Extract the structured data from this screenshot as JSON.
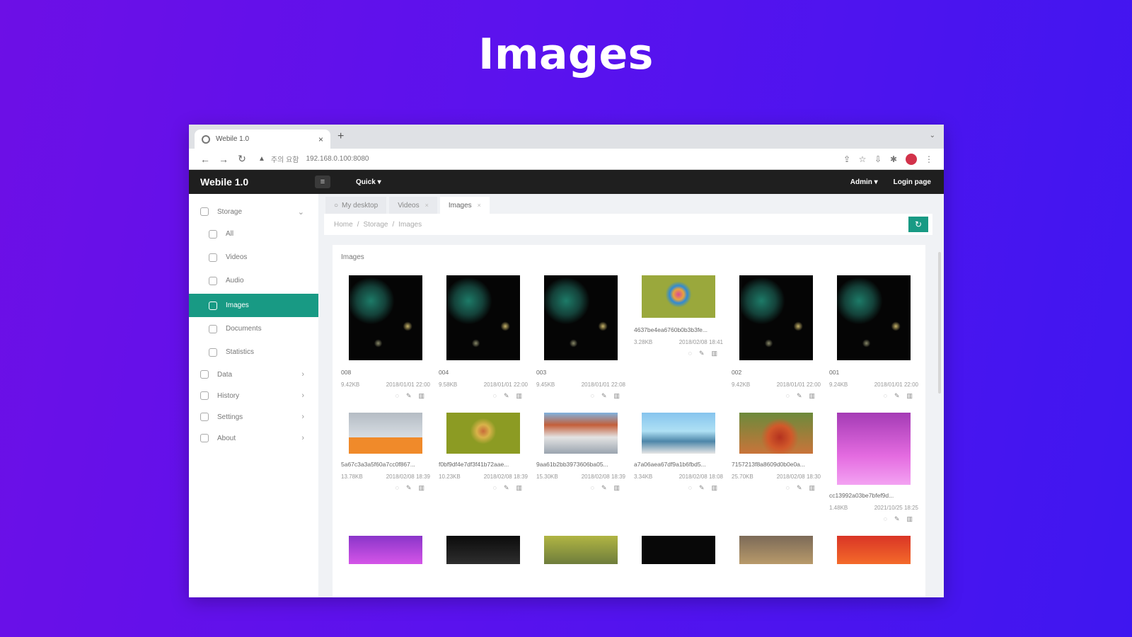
{
  "hero": {
    "title": "Images"
  },
  "browser": {
    "tab_title": "Webile 1.0",
    "new_tab": "+",
    "insecure_label": "주의 요함",
    "url": "192.168.0.100:8080"
  },
  "app": {
    "brand": "Webile 1.0",
    "quick_menu": "Quick",
    "admin_menu": "Admin",
    "logout": "Login page"
  },
  "sidebar": {
    "items": [
      {
        "label": "Storage"
      },
      {
        "label": "All"
      },
      {
        "label": "Videos"
      },
      {
        "label": "Audio"
      },
      {
        "label": "Images"
      },
      {
        "label": "Documents"
      },
      {
        "label": "Statistics"
      },
      {
        "label": "Data"
      },
      {
        "label": "History"
      },
      {
        "label": "Settings"
      },
      {
        "label": "About"
      }
    ]
  },
  "page_tabs": [
    {
      "label": "My desktop"
    },
    {
      "label": "Videos"
    },
    {
      "label": "Images"
    }
  ],
  "breadcrumb": {
    "home": "Home",
    "storage": "Storage",
    "current": "Images"
  },
  "panel": {
    "title": "Images"
  },
  "images": [
    {
      "name": "008",
      "size": "9.42KB",
      "date": "2018/01/01 22:00"
    },
    {
      "name": "004",
      "size": "9.58KB",
      "date": "2018/01/01 22:00"
    },
    {
      "name": "003",
      "size": "9.45KB",
      "date": "2018/01/01 22:08"
    },
    {
      "name": "4637be4ea6760b0b3b3fe...",
      "size": "3.28KB",
      "date": "2018/02/08 18:41"
    },
    {
      "name": "002",
      "size": "9.42KB",
      "date": "2018/01/01 22:00"
    },
    {
      "name": "001",
      "size": "9.24KB",
      "date": "2018/01/01 22:00"
    },
    {
      "name": "5a67c3a3a5f60a7cc0f867...",
      "size": "13.78KB",
      "date": "2018/02/08 18:39"
    },
    {
      "name": "f0bf9df4e7df3f41b72aae...",
      "size": "10.23KB",
      "date": "2018/02/08 18:39"
    },
    {
      "name": "9aa61b2bb3973606ba05...",
      "size": "15.30KB",
      "date": "2018/02/08 18:39"
    },
    {
      "name": "a7a06aea67df9a1b6fbd5...",
      "size": "3.34KB",
      "date": "2018/02/08 18:08"
    },
    {
      "name": "7157213f8a8609d0b0e0a...",
      "size": "25.70KB",
      "date": "2018/02/08 18:30"
    },
    {
      "name": "cc13992a03be7bfef9d...",
      "size": "1.48KB",
      "date": "2021/10/25 18:25"
    },
    {
      "name": "",
      "size": "",
      "date": ""
    },
    {
      "name": "",
      "size": "",
      "date": ""
    },
    {
      "name": "",
      "size": "",
      "date": ""
    },
    {
      "name": "",
      "size": "",
      "date": ""
    },
    {
      "name": "",
      "size": "",
      "date": ""
    },
    {
      "name": "",
      "size": "",
      "date": ""
    }
  ],
  "colors": {
    "accent": "#189a84",
    "header": "#1f1f1f",
    "background_from": "#6d0fe6",
    "background_to": "#3f16f0"
  }
}
